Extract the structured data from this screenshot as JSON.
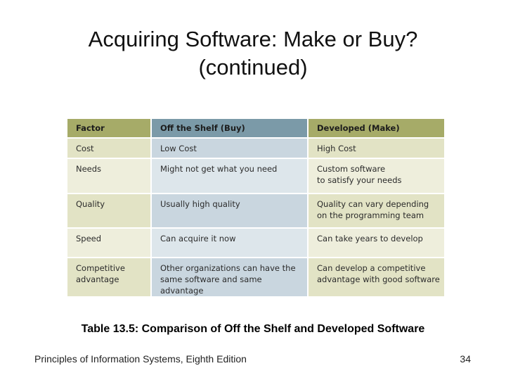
{
  "slide": {
    "title_line1": "Acquiring Software: Make or Buy?",
    "title_line2": "(continued)",
    "caption": "Table 13.5: Comparison of Off the Shelf and Developed Software",
    "footer_left": "Principles of Information Systems, Eighth Edition",
    "page_number": "34"
  },
  "table": {
    "headers": [
      "Factor",
      "Off the Shelf (Buy)",
      "Developed (Make)"
    ],
    "rows": [
      [
        "Cost",
        "Low Cost",
        "High Cost"
      ],
      [
        "Needs",
        "Might not get what you need",
        "Custom software\nto satisfy your needs"
      ],
      [
        "Quality",
        "Usually high quality",
        "Quality can vary depending\non the programming team"
      ],
      [
        "Speed",
        "Can acquire it now",
        "Can take years to develop"
      ],
      [
        "Competitive\nadvantage",
        "Other organizations can have the\nsame software and same advantage",
        "Can develop a competitive\nadvantage with good software"
      ]
    ],
    "colors": {
      "header_olive": "#a6ab68",
      "header_blue": "#7b9aa8"
    }
  }
}
